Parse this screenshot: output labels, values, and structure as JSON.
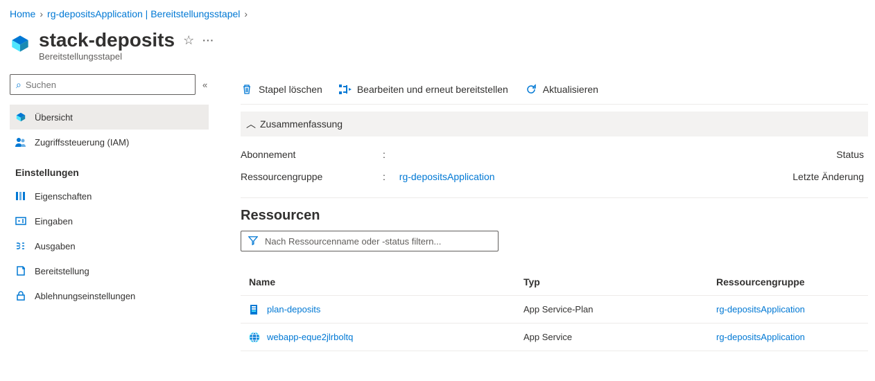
{
  "breadcrumb": {
    "home": "Home",
    "rg": "rg-depositsApplication | Bereitstellungsstapel"
  },
  "header": {
    "title": "stack-deposits",
    "subtitle": "Bereitstellungsstapel"
  },
  "search": {
    "placeholder": "Suchen"
  },
  "nav": {
    "overview": "Übersicht",
    "iam": "Zugriffssteuerung (IAM)",
    "settings_label": "Einstellungen",
    "properties": "Eigenschaften",
    "inputs": "Eingaben",
    "outputs": "Ausgaben",
    "deployment": "Bereitstellung",
    "deny": "Ablehnungseinstellungen"
  },
  "toolbar": {
    "delete": "Stapel löschen",
    "edit": "Bearbeiten und erneut bereitstellen",
    "refresh": "Aktualisieren"
  },
  "summary": {
    "title": "Zusammenfassung",
    "sub_label": "Abonnement",
    "rg_label": "Ressourcengruppe",
    "rg_value": "rg-depositsApplication",
    "status_label": "Status",
    "last_label": "Letzte Änderung",
    "colon": ":"
  },
  "resources": {
    "title": "Ressourcen",
    "filter_placeholder": "Nach Ressourcenname oder -status filtern...",
    "col_name": "Name",
    "col_type": "Typ",
    "col_rg": "Ressourcengruppe",
    "rows": [
      {
        "name": "plan-deposits",
        "type": "App Service-Plan",
        "rg": "rg-depositsApplication"
      },
      {
        "name": "webapp-eque2jlrboltq",
        "type": "App Service",
        "rg": "rg-depositsApplication"
      }
    ]
  }
}
